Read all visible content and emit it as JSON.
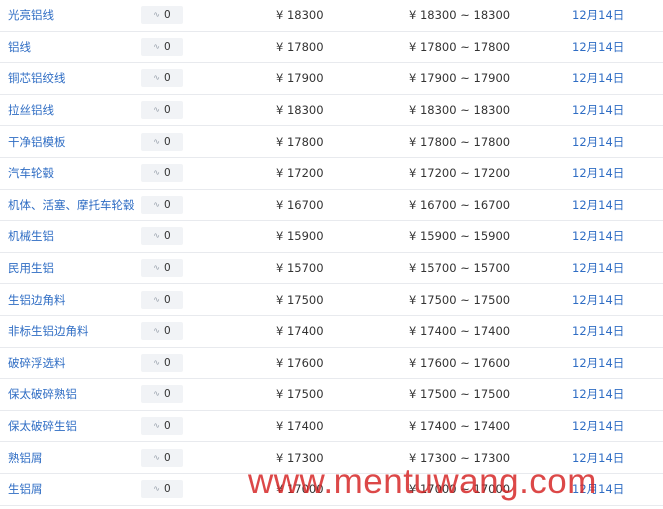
{
  "watermark": "www.mentuwang.com",
  "rows": [
    {
      "name": "光亮铝线",
      "change": "0",
      "price": "¥ 18300",
      "range": "¥ 18300 ~ 18300",
      "date": "12月14日"
    },
    {
      "name": "铝线",
      "change": "0",
      "price": "¥ 17800",
      "range": "¥ 17800 ~ 17800",
      "date": "12月14日"
    },
    {
      "name": "铜芯铝绞线",
      "change": "0",
      "price": "¥ 17900",
      "range": "¥ 17900 ~ 17900",
      "date": "12月14日"
    },
    {
      "name": "拉丝铝线",
      "change": "0",
      "price": "¥ 18300",
      "range": "¥ 18300 ~ 18300",
      "date": "12月14日"
    },
    {
      "name": "干净铝模板",
      "change": "0",
      "price": "¥ 17800",
      "range": "¥ 17800 ~ 17800",
      "date": "12月14日"
    },
    {
      "name": "汽车轮毂",
      "change": "0",
      "price": "¥ 17200",
      "range": "¥ 17200 ~ 17200",
      "date": "12月14日"
    },
    {
      "name": "机体、活塞、摩托车轮毂",
      "change": "0",
      "price": "¥ 16700",
      "range": "¥ 16700 ~ 16700",
      "date": "12月14日"
    },
    {
      "name": "机械生铝",
      "change": "0",
      "price": "¥ 15900",
      "range": "¥ 15900 ~ 15900",
      "date": "12月14日"
    },
    {
      "name": "民用生铝",
      "change": "0",
      "price": "¥ 15700",
      "range": "¥ 15700 ~ 15700",
      "date": "12月14日"
    },
    {
      "name": "生铝边角料",
      "change": "0",
      "price": "¥ 17500",
      "range": "¥ 17500 ~ 17500",
      "date": "12月14日"
    },
    {
      "name": "非标生铝边角料",
      "change": "0",
      "price": "¥ 17400",
      "range": "¥ 17400 ~ 17400",
      "date": "12月14日"
    },
    {
      "name": "破碎浮选料",
      "change": "0",
      "price": "¥ 17600",
      "range": "¥ 17600 ~ 17600",
      "date": "12月14日"
    },
    {
      "name": "保太破碎熟铝",
      "change": "0",
      "price": "¥ 17500",
      "range": "¥ 17500 ~ 17500",
      "date": "12月14日"
    },
    {
      "name": "保太破碎生铝",
      "change": "0",
      "price": "¥ 17400",
      "range": "¥ 17400 ~ 17400",
      "date": "12月14日"
    },
    {
      "name": "熟铝屑",
      "change": "0",
      "price": "¥ 17300",
      "range": "¥ 17300 ~ 17300",
      "date": "12月14日"
    },
    {
      "name": "生铝屑",
      "change": "0",
      "price": "¥ 17000",
      "range": "¥ 17000 ~ 17000",
      "date": "12月14日"
    }
  ]
}
